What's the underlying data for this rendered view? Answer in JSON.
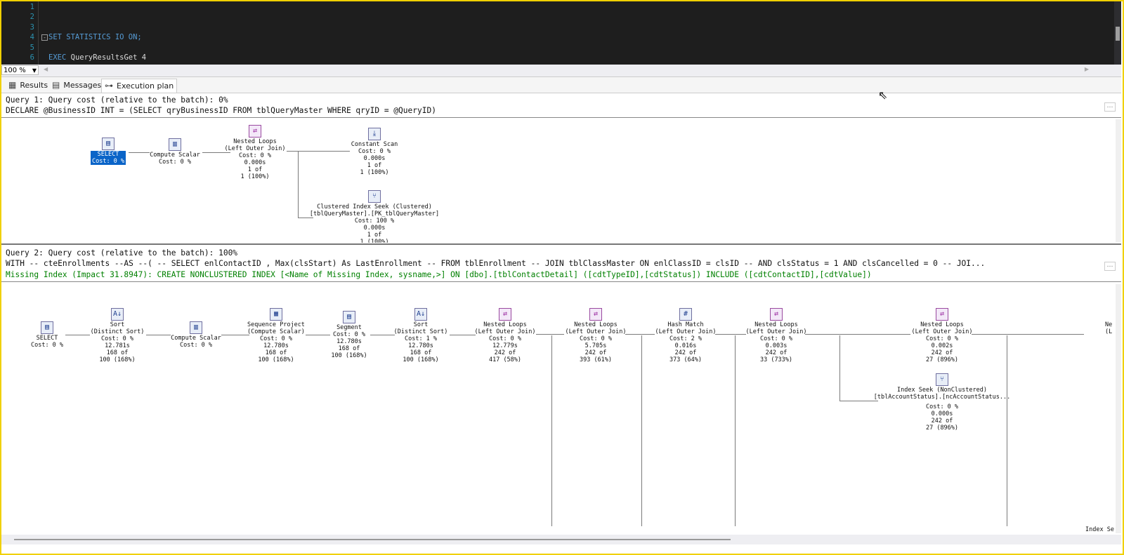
{
  "editor": {
    "line_numbers": [
      "1",
      "2",
      "3",
      "4",
      "5",
      "6"
    ],
    "line4_kw": "SET STATISTICS IO ON;",
    "line6_kw": "EXEC",
    "line6_rest": " QueryResultsGet 4"
  },
  "zoom": {
    "value": "100 %"
  },
  "tabs": [
    {
      "label": "Results",
      "icon": "grid-icon"
    },
    {
      "label": "Messages",
      "icon": "messages-icon"
    },
    {
      "label": "Execution plan",
      "icon": "plan-icon"
    }
  ],
  "query1": {
    "header": "Query 1: Query cost (relative to the batch): 0%",
    "statement": "DECLARE @BusinessID INT = (SELECT qryBusinessID FROM tblQueryMaster WHERE qryID = @QueryID)",
    "nodes": {
      "select": {
        "l1": "SELECT",
        "l2": "Cost: 0 %"
      },
      "compute": {
        "l1": "Compute Scalar",
        "l2": "Cost: 0 %"
      },
      "nested": {
        "l1": "Nested Loops",
        "l2": "(Left Outer Join)",
        "l3": "Cost: 0 %",
        "l4": "0.000s",
        "l5": "1 of",
        "l6": "1 (100%)"
      },
      "constant": {
        "l1": "Constant Scan",
        "l2": "Cost: 0 %",
        "l3": "0.000s",
        "l4": "1 of",
        "l5": "1 (100%)"
      },
      "seek": {
        "l1": "Clustered Index Seek (Clustered)",
        "l2": "[tblQueryMaster].[PK_tblQueryMaster]",
        "l3": "Cost: 100 %",
        "l4": "0.000s",
        "l5": "1 of",
        "l6": "1 (100%)"
      }
    }
  },
  "query2": {
    "header": "Query 2: Query cost (relative to the batch): 100%",
    "statement": "WITH -- cteEnrollments --AS --( -- SELECT enlContactID , Max(clsStart) As LastEnrollment -- FROM tblEnrollment -- JOIN tblClassMaster ON enlClassID = clsID -- AND clsStatus = 1 AND clsCancelled = 0 -- JOI...",
    "missing_index": "Missing Index (Impact 31.8947): CREATE NONCLUSTERED INDEX [<Name of Missing Index, sysname,>] ON [dbo].[tblContactDetail] ([cdtTypeID],[cdtStatus]) INCLUDE ([cdtContactID],[cdtValue])",
    "nodes": {
      "select": {
        "l1": "SELECT",
        "l2": "Cost: 0 %"
      },
      "sort1": {
        "l1": "Sort",
        "l2": "(Distinct Sort)",
        "l3": "Cost: 0 %",
        "l4": "12.781s",
        "l5": "168 of",
        "l6": "100 (168%)"
      },
      "compute": {
        "l1": "Compute Scalar",
        "l2": "Cost: 0 %"
      },
      "seqproj": {
        "l1": "Sequence Project",
        "l2": "(Compute Scalar)",
        "l3": "Cost: 0 %",
        "l4": "12.780s",
        "l5": "168 of",
        "l6": "100 (168%)"
      },
      "segment": {
        "l1": "Segment",
        "l2": "Cost: 0 %",
        "l3": "12.780s",
        "l4": "168 of",
        "l5": "100 (168%)"
      },
      "sort2": {
        "l1": "Sort",
        "l2": "(Distinct Sort)",
        "l3": "Cost: 1 %",
        "l4": "12.780s",
        "l5": "168 of",
        "l6": "100 (168%)"
      },
      "nl1": {
        "l1": "Nested Loops",
        "l2": "(Left Outer Join)",
        "l3": "Cost: 0 %",
        "l4": "12.779s",
        "l5": "242 of",
        "l6": "417 (58%)"
      },
      "nl2": {
        "l1": "Nested Loops",
        "l2": "(Left Outer Join)",
        "l3": "Cost: 0 %",
        "l4": "5.705s",
        "l5": "242 of",
        "l6": "393 (61%)"
      },
      "hash": {
        "l1": "Hash Match",
        "l2": "(Left Outer Join)",
        "l3": "Cost: 2 %",
        "l4": "0.016s",
        "l5": "242 of",
        "l6": "373 (64%)"
      },
      "nl3": {
        "l1": "Nested Loops",
        "l2": "(Left Outer Join)",
        "l3": "Cost: 0 %",
        "l4": "0.003s",
        "l5": "242 of",
        "l6": "33 (733%)"
      },
      "nl4": {
        "l1": "Nested Loops",
        "l2": "(Left Outer Join)",
        "l3": "Cost: 0 %",
        "l4": "0.002s",
        "l5": "242 of",
        "l6": "27 (896%)"
      },
      "ixseek": {
        "l1": "Index Seek (NonClustered)",
        "l2": "[tblAccountStatus].[ncAccountStatus...",
        "l3": "Cost: 0 %",
        "l4": "0.000s",
        "l5": "242 of",
        "l6": "27 (896%)"
      },
      "edge_right": {
        "l1": "Ne",
        "l2": "(L"
      },
      "edge_bottom": {
        "l1": "Index Se"
      }
    }
  }
}
